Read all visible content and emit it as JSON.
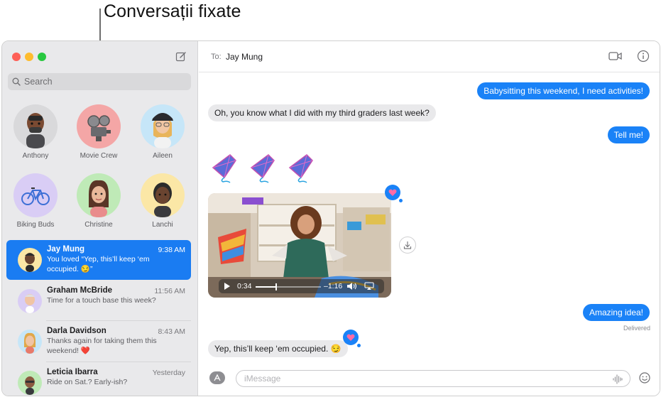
{
  "callout": {
    "text": "Conversații fixate"
  },
  "window": {
    "search_placeholder": "Search",
    "pinned": [
      {
        "name": "Anthony",
        "bg": "#d9d9db"
      },
      {
        "name": "Movie Crew",
        "bg": "#f4a6a6"
      },
      {
        "name": "Aileen",
        "bg": "#c6e6f8"
      },
      {
        "name": "Biking Buds",
        "bg": "#d9cdf5"
      },
      {
        "name": "Christine",
        "bg": "#bfeab7"
      },
      {
        "name": "Lanchi",
        "bg": "#fbe7a6"
      }
    ],
    "conversations": [
      {
        "name": "Jay Mung",
        "time": "9:38 AM",
        "preview": "You loved “Yep, this’ll keep ‘em occupied. 😏”",
        "active": true
      },
      {
        "name": "Graham McBride",
        "time": "11:56 AM",
        "preview": "Time for a touch base this week?"
      },
      {
        "name": "Darla Davidson",
        "time": "8:43 AM",
        "preview": "Thanks again for taking them this weekend! ❤️"
      },
      {
        "name": "Leticia Ibarra",
        "time": "Yesterday",
        "preview": "Ride on Sat.? Early-ish?"
      }
    ],
    "chat": {
      "to_label": "To:",
      "recipient": "Jay Mung",
      "messages": {
        "m1": "Babysitting this weekend, I need activities!",
        "m2": "Oh, you know what I did with my third graders last week?",
        "m3": "Tell me!",
        "m4": "Amazing idea!",
        "m5": "Yep, this’ll keep ‘em occupied. 😏"
      },
      "delivered": "Delivered",
      "video": {
        "elapsed": "0:34",
        "remaining": "–1:16",
        "progress": 0.3
      },
      "input_placeholder": "iMessage"
    },
    "colors": {
      "accent": "#1a82f7",
      "selection": "#1a7cf2"
    }
  }
}
